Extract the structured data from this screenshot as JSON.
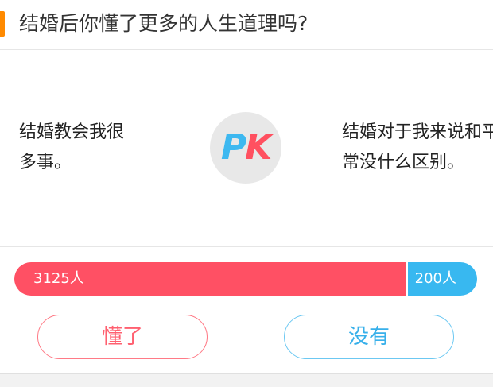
{
  "header": {
    "title": "结婚后你懂了更多的人生道理吗?"
  },
  "options": {
    "left_text": "结婚教会我很多事。",
    "right_text": "结婚对于我来说和平常没什么区别。"
  },
  "pk_badge": {
    "letter_p": "P",
    "letter_k": "K"
  },
  "votes": {
    "left_count_label": "3125人",
    "right_count_label": "200人",
    "left_fraction": 0.8498
  },
  "buttons": {
    "yes_label": "懂了",
    "no_label": "没有"
  },
  "colors": {
    "accent": "#ff8a00",
    "left_vote": "#ff5064",
    "right_vote": "#38b8f0"
  }
}
